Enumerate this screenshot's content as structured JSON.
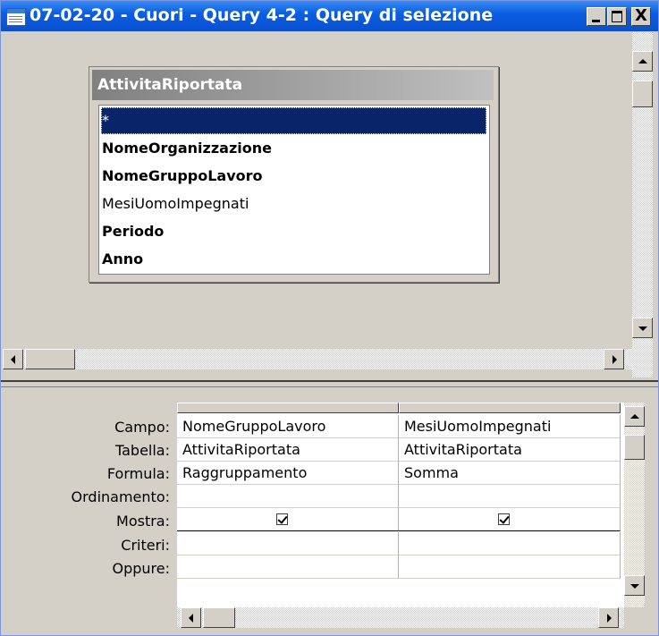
{
  "window": {
    "title": "07-02-20 - Cuori - Query 4-2 : Query di selezione",
    "close_glyph": "X"
  },
  "table": {
    "name": "AttivitaRiportata",
    "fields": [
      {
        "label": "*",
        "bold": false,
        "selected": true
      },
      {
        "label": "NomeOrganizzazione",
        "bold": true,
        "selected": false
      },
      {
        "label": "NomeGruppoLavoro",
        "bold": true,
        "selected": false
      },
      {
        "label": "MesiUomoImpegnati",
        "bold": false,
        "selected": false
      },
      {
        "label": "Periodo",
        "bold": true,
        "selected": false
      },
      {
        "label": "Anno",
        "bold": true,
        "selected": false
      }
    ]
  },
  "grid": {
    "row_labels": [
      "Campo:",
      "Tabella:",
      "Formula:",
      "Ordinamento:",
      "Mostra:",
      "Criteri:",
      "Oppure:"
    ],
    "columns": [
      {
        "campo": "NomeGruppoLavoro",
        "tabella": "AttivitaRiportata",
        "formula": "Raggruppamento",
        "ordinamento": "",
        "mostra": true,
        "criteri": "",
        "oppure": ""
      },
      {
        "campo": "MesiUomoImpegnati",
        "tabella": "AttivitaRiportata",
        "formula": "Somma",
        "ordinamento": "",
        "mostra": true,
        "criteri": "",
        "oppure": ""
      }
    ]
  },
  "colors": {
    "titlebar": "#0a5fe0",
    "selection": "#0a246a",
    "face": "#d4d0c8"
  }
}
